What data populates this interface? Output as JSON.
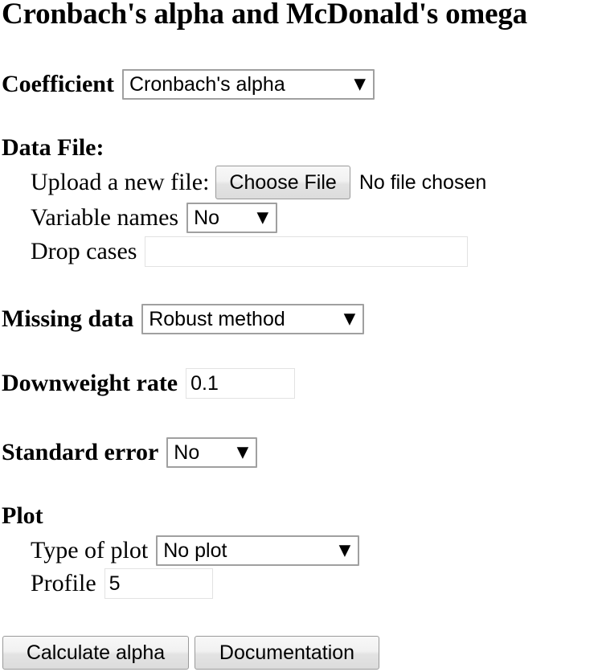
{
  "page": {
    "title": "Cronbach's alpha and McDonald's omega"
  },
  "coefficient": {
    "label": "Coefficient",
    "value": "Cronbach's alpha",
    "caret": "▼"
  },
  "data_file": {
    "heading": "Data File:",
    "upload": {
      "label": "Upload a new file:",
      "button_label": "Choose File",
      "file_status": "No file chosen"
    },
    "variable_names": {
      "label": "Variable names",
      "value": "No",
      "caret": "▼"
    },
    "drop_cases": {
      "label": "Drop cases",
      "value": "",
      "placeholder": ""
    }
  },
  "missing_data": {
    "label": "Missing data",
    "value": "Robust method",
    "caret": "▼"
  },
  "downweight_rate": {
    "label": "Downweight rate",
    "value": "0.1"
  },
  "standard_error": {
    "label": "Standard error",
    "value": "No",
    "caret": "▼"
  },
  "plot": {
    "heading": "Plot",
    "type_of_plot": {
      "label": "Type of plot",
      "value": "No plot",
      "caret": "▼"
    },
    "profile": {
      "label": "Profile",
      "value": "5"
    }
  },
  "actions": {
    "calculate_label": "Calculate alpha",
    "documentation_label": "Documentation"
  },
  "colors": {
    "background": "#ffffff",
    "text": "#000000",
    "select_border": "#a0a0a0",
    "input_border": "#e2e2e2",
    "button_border": "#9a9a9a",
    "button_face": "#eeeeee"
  }
}
